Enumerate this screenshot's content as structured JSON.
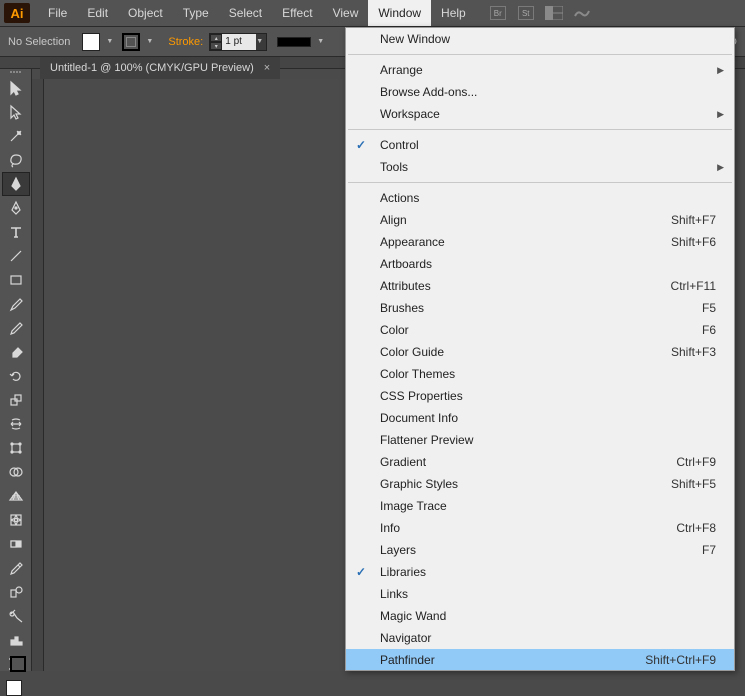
{
  "app": {
    "logo": "Ai"
  },
  "menubar": {
    "items": [
      {
        "label": "File"
      },
      {
        "label": "Edit"
      },
      {
        "label": "Object"
      },
      {
        "label": "Type"
      },
      {
        "label": "Select"
      },
      {
        "label": "Effect"
      },
      {
        "label": "View"
      },
      {
        "label": "Window",
        "open": true
      },
      {
        "label": "Help"
      }
    ],
    "icons": [
      "Br",
      "St",
      "layout-icon",
      "cloud-icon"
    ]
  },
  "controlbar": {
    "status": "No Selection",
    "stroke_label": "Stroke:",
    "stroke_value": "1 pt",
    "trailing": "D"
  },
  "document": {
    "tab_title": "Untitled-1 @ 100% (CMYK/GPU Preview)"
  },
  "toolbox": {
    "tools": [
      "selection-tool",
      "direct-selection-tool",
      "magic-wand-tool",
      "lasso-tool",
      "pen-tool",
      "curvature-tool",
      "type-tool",
      "line-segment-tool",
      "rectangle-tool",
      "paintbrush-tool",
      "pencil-tool",
      "eraser-tool",
      "rotate-tool",
      "scale-tool",
      "width-tool",
      "free-transform-tool",
      "shape-builder-tool",
      "perspective-grid-tool",
      "mesh-tool",
      "gradient-tool",
      "eyedropper-tool",
      "blend-tool",
      "symbol-sprayer-tool",
      "column-graph-tool",
      "artboard-tool"
    ],
    "active_index": 4
  },
  "dropdown": {
    "sections": [
      [
        {
          "label": "New Window"
        }
      ],
      [
        {
          "label": "Arrange",
          "submenu": true
        },
        {
          "label": "Browse Add-ons..."
        },
        {
          "label": "Workspace",
          "submenu": true
        }
      ],
      [
        {
          "label": "Control",
          "checked": true
        },
        {
          "label": "Tools",
          "submenu": true
        }
      ],
      [
        {
          "label": "Actions"
        },
        {
          "label": "Align",
          "shortcut": "Shift+F7"
        },
        {
          "label": "Appearance",
          "shortcut": "Shift+F6"
        },
        {
          "label": "Artboards"
        },
        {
          "label": "Attributes",
          "shortcut": "Ctrl+F11"
        },
        {
          "label": "Brushes",
          "shortcut": "F5"
        },
        {
          "label": "Color",
          "shortcut": "F6"
        },
        {
          "label": "Color Guide",
          "shortcut": "Shift+F3"
        },
        {
          "label": "Color Themes"
        },
        {
          "label": "CSS Properties"
        },
        {
          "label": "Document Info"
        },
        {
          "label": "Flattener Preview"
        },
        {
          "label": "Gradient",
          "shortcut": "Ctrl+F9"
        },
        {
          "label": "Graphic Styles",
          "shortcut": "Shift+F5"
        },
        {
          "label": "Image Trace"
        },
        {
          "label": "Info",
          "shortcut": "Ctrl+F8"
        },
        {
          "label": "Layers",
          "shortcut": "F7"
        },
        {
          "label": "Libraries",
          "checked": true
        },
        {
          "label": "Links"
        },
        {
          "label": "Magic Wand"
        },
        {
          "label": "Navigator"
        },
        {
          "label": "Pathfinder",
          "shortcut": "Shift+Ctrl+F9",
          "highlight": true
        }
      ]
    ]
  }
}
